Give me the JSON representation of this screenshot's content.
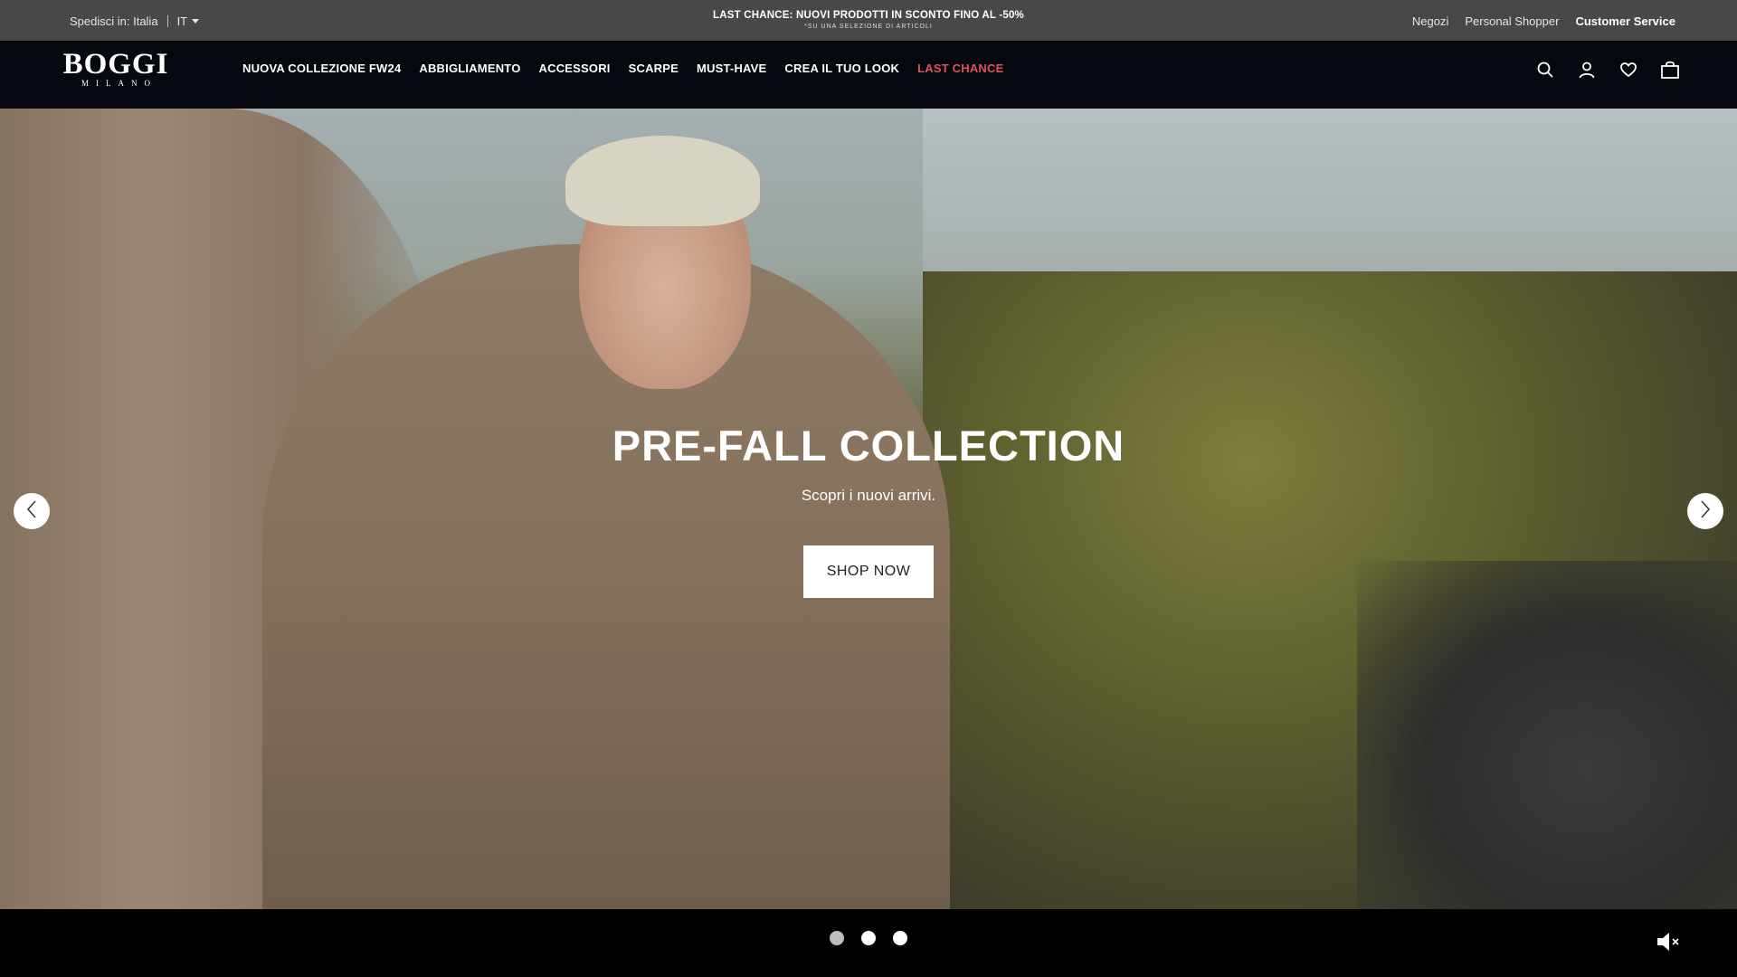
{
  "topbar": {
    "ship_label": "Spedisci in: Italia",
    "lang": "IT",
    "promo_main": "LAST CHANCE: NUOVI PRODOTTI IN SCONTO FINO AL -50%",
    "promo_sub": "*SU UNA SELEZIONE DI ARTICOLI",
    "links": [
      "Negozi",
      "Personal Shopper",
      "Customer Service"
    ]
  },
  "logo": {
    "main": "BOGGI",
    "sub": "MILANO"
  },
  "nav": {
    "items": [
      "NUOVA COLLEZIONE FW24",
      "ABBIGLIAMENTO",
      "ACCESSORI",
      "SCARPE",
      "MUST-HAVE",
      "CREA IL TUO LOOK",
      "LAST CHANCE"
    ],
    "accent_color": "#e0525c"
  },
  "icons": [
    "search-icon",
    "user-icon",
    "heart-icon",
    "bag-icon"
  ],
  "hero": {
    "title": "PRE-FALL COLLECTION",
    "subtitle": "Scopri i nuovi arrivi.",
    "cta": "SHOP NOW"
  },
  "carousel": {
    "slides": 3,
    "active": 1
  }
}
